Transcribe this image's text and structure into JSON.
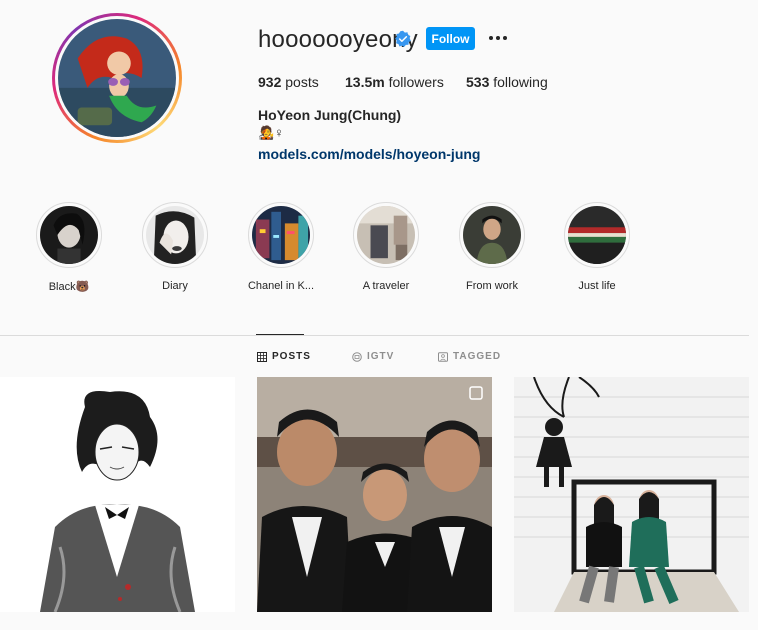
{
  "profile": {
    "username": "hooooooyeony",
    "follow_label": "Follow",
    "posts_count": "932",
    "posts_label": "posts",
    "followers_count": "13.5m",
    "followers_label": "followers",
    "following_count": "533",
    "following_label": "following",
    "full_name": "HoYeon Jung(Chung)",
    "bio_emojis": "🧑‍🎤♀",
    "link": "models.com/models/hoyeon-jung"
  },
  "highlights": [
    {
      "label": "Black🐻"
    },
    {
      "label": "Diary"
    },
    {
      "label": "Chanel in K..."
    },
    {
      "label": "A traveler"
    },
    {
      "label": "From work"
    },
    {
      "label": "Just life"
    }
  ],
  "tabs": [
    {
      "label": "POSTS",
      "active": true
    },
    {
      "label": "IGTV",
      "active": false
    },
    {
      "label": "TAGGED",
      "active": false
    }
  ],
  "colors": {
    "follow_button": "#0095f6",
    "verified_badge": "#3897f0",
    "link": "#00376b"
  }
}
